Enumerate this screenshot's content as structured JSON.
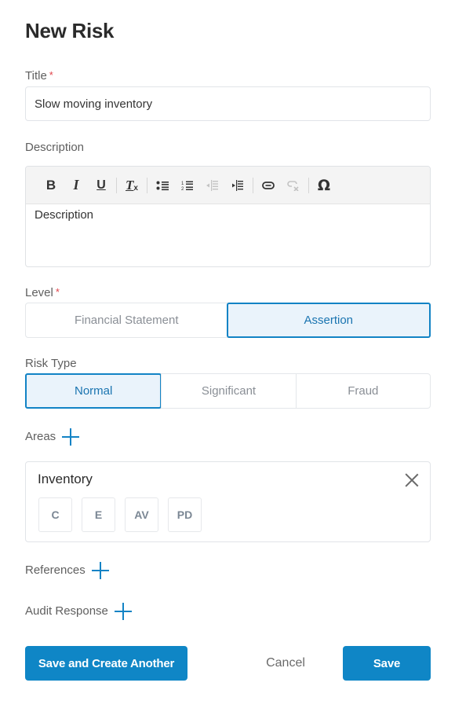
{
  "page": {
    "title": "New Risk"
  },
  "form": {
    "title_field": {
      "label": "Title",
      "required_mark": "*",
      "value": "Slow moving inventory"
    },
    "description": {
      "label": "Description",
      "placeholder": "Description",
      "toolbar": [
        {
          "icon": "bold-icon",
          "glyph": "B",
          "enabled": true
        },
        {
          "icon": "italic-icon",
          "glyph": "I",
          "enabled": true
        },
        {
          "icon": "underline-icon",
          "glyph": "U",
          "enabled": true
        },
        {
          "icon": "remove-format-icon",
          "glyph": "Tx",
          "enabled": true
        },
        {
          "icon": "bulleted-list-icon",
          "glyph": "•≡",
          "enabled": true
        },
        {
          "icon": "numbered-list-icon",
          "glyph": "1≡",
          "enabled": true
        },
        {
          "icon": "decrease-indent-icon",
          "glyph": "⇤",
          "enabled": false
        },
        {
          "icon": "increase-indent-icon",
          "glyph": "⇥",
          "enabled": true
        },
        {
          "icon": "link-icon",
          "glyph": "🔗",
          "enabled": true
        },
        {
          "icon": "unlink-icon",
          "glyph": "⛓",
          "enabled": false
        },
        {
          "icon": "special-character-icon",
          "glyph": "Ω",
          "enabled": true
        }
      ]
    },
    "level": {
      "label": "Level",
      "required_mark": "*",
      "options": [
        "Financial Statement",
        "Assertion"
      ],
      "selected": "Assertion"
    },
    "risk_type": {
      "label": "Risk Type",
      "options": [
        "Normal",
        "Significant",
        "Fraud"
      ],
      "selected": "Normal"
    },
    "areas": {
      "label": "Areas",
      "add_icon": "plus-icon",
      "items": [
        {
          "name": "Inventory",
          "assertions": [
            "C",
            "E",
            "AV",
            "PD"
          ]
        }
      ]
    },
    "references": {
      "label": "References",
      "add_icon": "plus-icon"
    },
    "audit_response": {
      "label": "Audit Response",
      "add_icon": "plus-icon"
    }
  },
  "actions": {
    "save_and_create_another": "Save and Create Another",
    "cancel": "Cancel",
    "save": "Save"
  },
  "colors": {
    "primary": "#0f86c6",
    "selected_bg": "#eaf3fb",
    "required": "#e0444b"
  }
}
